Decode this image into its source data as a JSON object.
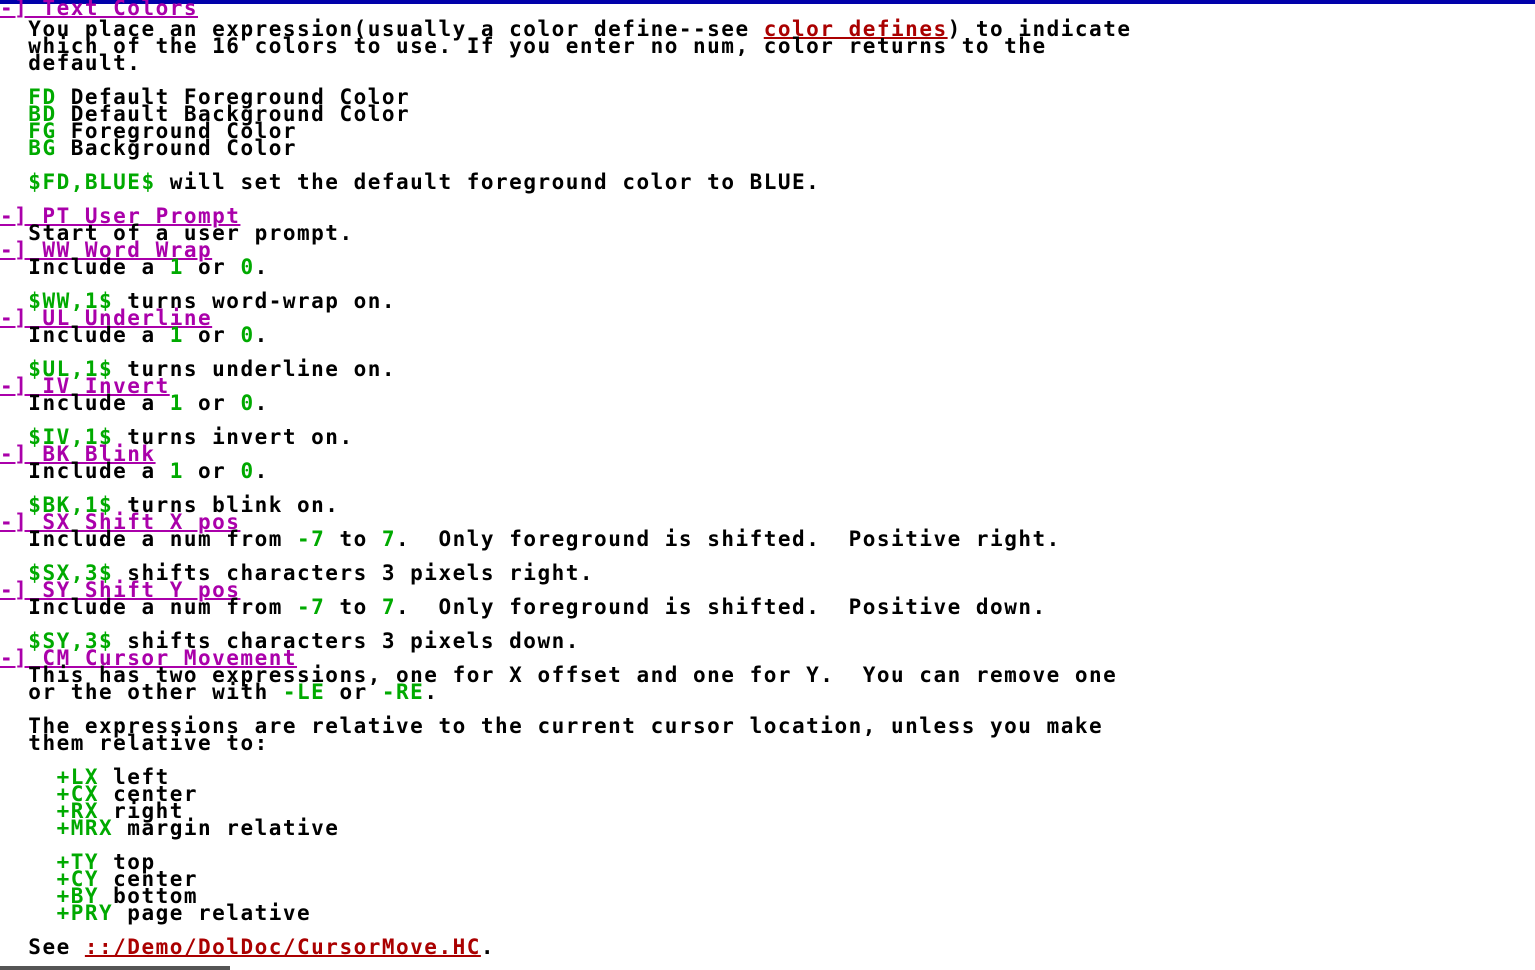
{
  "text_colors": {
    "header": "-] Text Colors",
    "desc1a": "You place an expression(usually a color define--see ",
    "desc1_link": "color defines",
    "desc1b": ") to indicate",
    "desc2": "which of the 16 colors to use. If you enter no num, color returns to the",
    "desc3": "default.",
    "codes": [
      {
        "code": "FD",
        "label": " Default Foreground Color"
      },
      {
        "code": "BD",
        "label": " Default Background Color"
      },
      {
        "code": "FG",
        "label": " Foreground Color"
      },
      {
        "code": "BG",
        "label": " Background Color"
      }
    ],
    "example_code": "$FD,BLUE$",
    "example_text": " will set the default foreground color to BLUE."
  },
  "pt": {
    "header": "-] PT User Prompt",
    "desc": "Start of a user prompt."
  },
  "ww": {
    "header": "-] WW Word Wrap",
    "inc": "Include a ",
    "one": "1",
    "or": " or ",
    "zero": "0",
    "dot": ".",
    "ex_code": "$WW,1$",
    "ex_text": " turns word-wrap on."
  },
  "ul": {
    "header": "-] UL Underline",
    "inc": "Include a ",
    "one": "1",
    "or": " or ",
    "zero": "0",
    "dot": ".",
    "ex_code": "$UL,1$",
    "ex_text": " turns underline on."
  },
  "iv": {
    "header": "-] IV Invert",
    "inc": "Include a ",
    "one": "1",
    "or": " or ",
    "zero": "0",
    "dot": ".",
    "ex_code": "$IV,1$",
    "ex_text": " turns invert on."
  },
  "bk": {
    "header": "-] BK Blink",
    "inc": "Include a ",
    "one": "1",
    "or": " or ",
    "zero": "0",
    "dot": ".",
    "ex_code": "$BK,1$",
    "ex_text": " turns blink on."
  },
  "sx": {
    "header": "-] SX Shift X pos",
    "inc": "Include a num from ",
    "neg": "-7",
    "to": " to ",
    "pos": "7",
    "rest": ".  Only foreground is shifted.  Positive right.",
    "ex_code": "$SX,3$",
    "ex_text": " shifts characters 3 pixels right."
  },
  "sy": {
    "header": "-] SY Shift Y pos",
    "inc": "Include a num from ",
    "neg": "-7",
    "to": " to ",
    "pos": "7",
    "rest": ".  Only foreground is shifted.  Positive down.",
    "ex_code": "$SY,3$",
    "ex_text": " shifts characters 3 pixels down."
  },
  "cm": {
    "header": "-] CM Cursor Movement",
    "desc1": "This has two expressions, one for X offset and one for Y.  You can remove one",
    "desc2a": "or the other with ",
    "le": "-LE",
    "or": " or ",
    "re": "-RE",
    "dot": ".",
    "rel1": "The expressions are relative to the current cursor location, unless you make",
    "rel2": "them relative to:",
    "x_items": [
      {
        "code": "+LX",
        "label": " left"
      },
      {
        "code": "+CX",
        "label": " center"
      },
      {
        "code": "+RX",
        "label": " right"
      },
      {
        "code": "+MRX",
        "label": " margin relative"
      }
    ],
    "y_items": [
      {
        "code": "+TY",
        "label": " top"
      },
      {
        "code": "+CY",
        "label": " center"
      },
      {
        "code": "+BY",
        "label": " bottom"
      },
      {
        "code": "+PRY",
        "label": " page relative"
      }
    ],
    "see": "See ",
    "see_link": "::/Demo/DolDoc/CursorMove.HC",
    "see_dot": "."
  }
}
